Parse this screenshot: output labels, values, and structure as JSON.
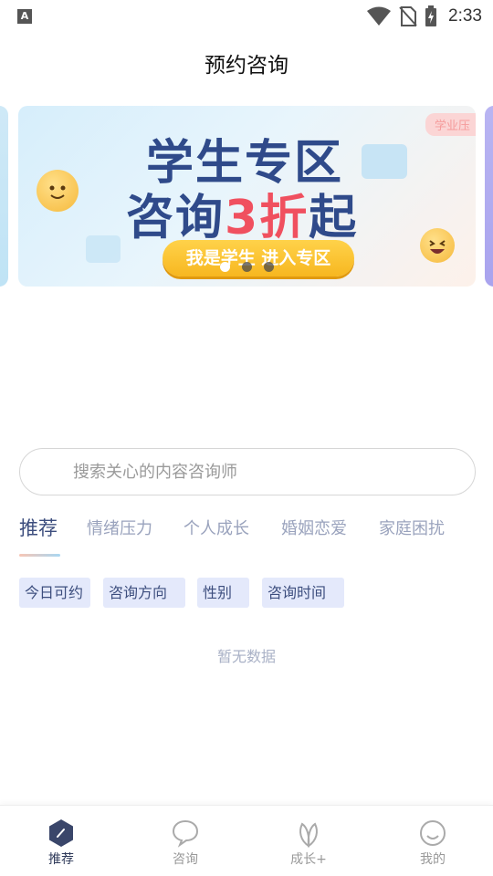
{
  "status_bar": {
    "app_icon_letter": "A",
    "time": "2:33",
    "icons": [
      "wifi-icon",
      "no-sim-icon",
      "battery-charging-icon"
    ]
  },
  "header": {
    "title": "预约咨询"
  },
  "banner": {
    "tag": "学业压",
    "line1": "学生专区",
    "line2_prefix": "咨询",
    "line2_accent": "3折",
    "line2_suffix": "起",
    "cta": "我是学生 进入专区",
    "page_count": 3,
    "active_page": 1
  },
  "search": {
    "placeholder": "搜索关心的内容咨询师"
  },
  "tabs": [
    {
      "label": "推荐",
      "active": true
    },
    {
      "label": "情绪压力",
      "active": false
    },
    {
      "label": "个人成长",
      "active": false
    },
    {
      "label": "婚姻恋爱",
      "active": false
    },
    {
      "label": "家庭困扰",
      "active": false
    }
  ],
  "filters": [
    "今日可约",
    "咨询方向",
    "性别",
    "咨询时间"
  ],
  "empty_state": "暂无数据",
  "bottom_nav": [
    {
      "label": "推荐",
      "icon": "home-hexagon-icon",
      "active": true
    },
    {
      "label": "咨询",
      "icon": "chat-bubble-icon",
      "active": false
    },
    {
      "label": "成长+",
      "icon": "leaf-icon",
      "active": false
    },
    {
      "label": "我的",
      "icon": "smiley-face-icon",
      "active": false
    }
  ],
  "colors": {
    "accent": "#3d4e7e",
    "tab_inactive": "#9aa3bd",
    "filter_bg": "#e4e9fb",
    "banner_title": "#2f4a8a",
    "banner_highlight": "#f0505f",
    "cta_yellow": "#f7b720"
  }
}
